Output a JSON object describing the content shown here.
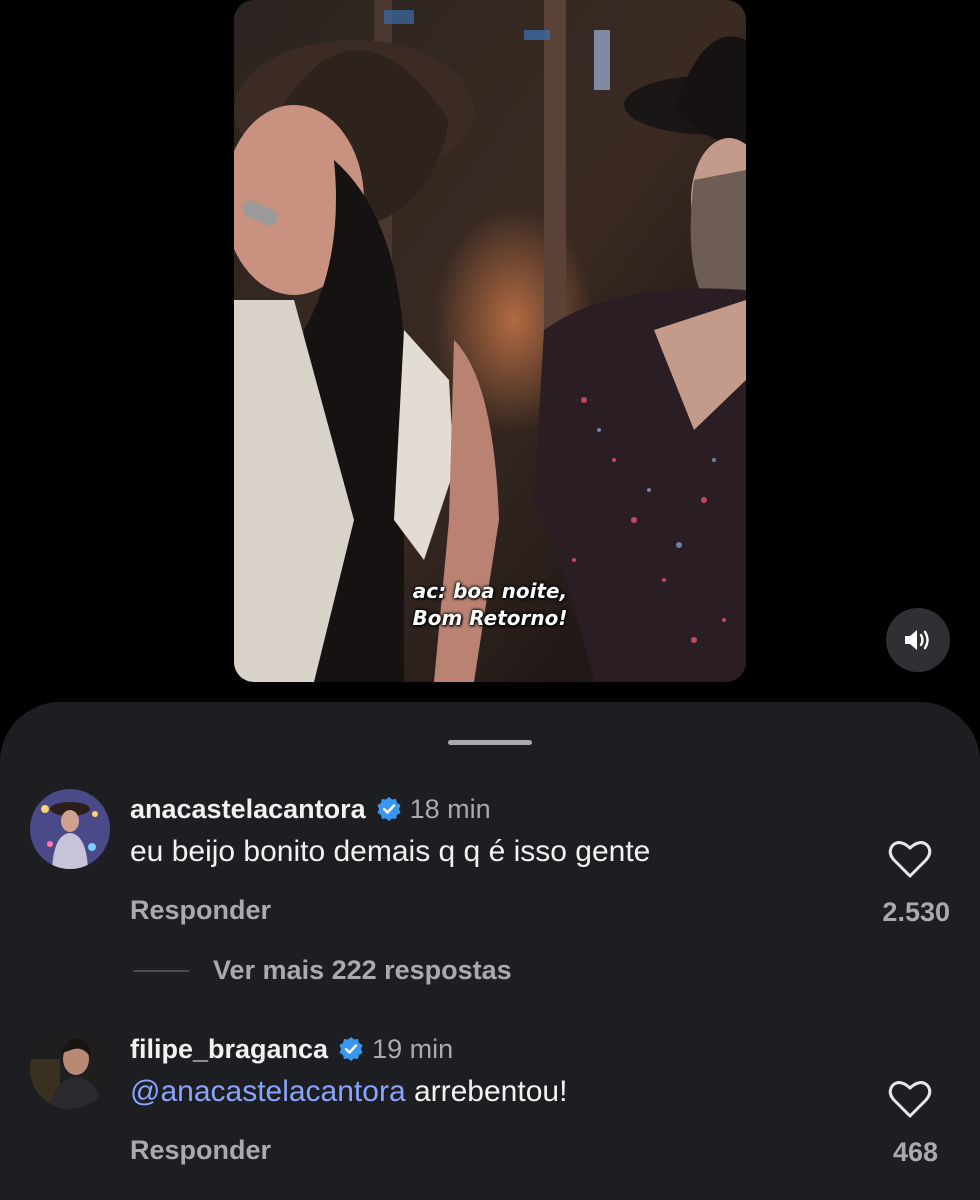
{
  "video": {
    "caption_line1": "ac: boa noite,",
    "caption_line2": "Bom Retorno!",
    "sound_icon": "speaker-on-icon"
  },
  "comments": [
    {
      "username": "anacastelacantora",
      "verified": true,
      "time": "18 min",
      "mention": "",
      "text": "eu beijo bonito demais q q é isso gente",
      "reply_label": "Responder",
      "likes": "2.530",
      "more_replies": "Ver mais 222 respostas"
    },
    {
      "username": "filipe_braganca",
      "verified": true,
      "time": "19 min",
      "mention": "@anacastelacantora",
      "text": " arrebentou!",
      "reply_label": "Responder",
      "likes": "468"
    }
  ],
  "colors": {
    "background": "#000000",
    "sheet": "#1c1e21",
    "mention": "#8aa3ff",
    "verified": "#3897f0",
    "muted_text": "#a8aaae"
  }
}
